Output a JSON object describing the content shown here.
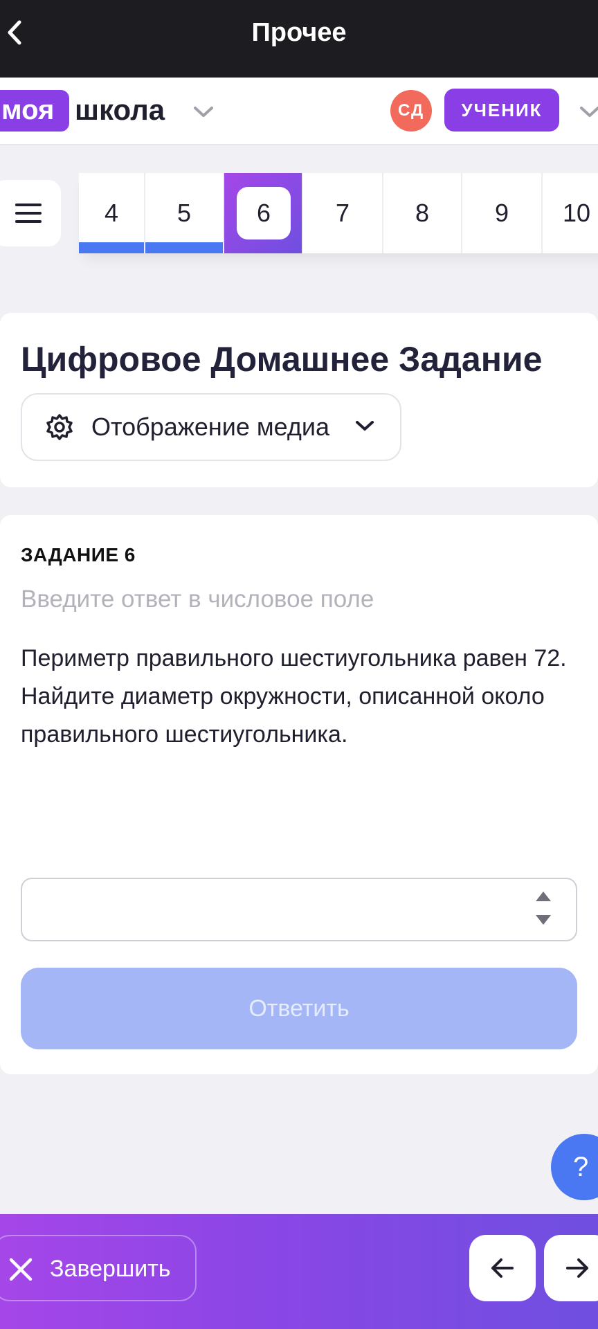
{
  "topbar": {
    "title": "Прочее"
  },
  "header": {
    "logo_part1": "моя",
    "logo_part2": "школа",
    "avatar_initials": "СД",
    "role": "УЧЕНИК"
  },
  "tasks": {
    "items": [
      {
        "label": "4",
        "state": "done"
      },
      {
        "label": "5",
        "state": "done"
      },
      {
        "label": "6",
        "state": "active"
      },
      {
        "label": "7",
        "state": "pending"
      },
      {
        "label": "8",
        "state": "pending"
      },
      {
        "label": "9",
        "state": "pending"
      },
      {
        "label": "10",
        "state": "pending"
      }
    ]
  },
  "homework": {
    "title": "Цифровое Домашнее Задание",
    "media_label": "Отображение медиа"
  },
  "task": {
    "label": "ЗАДАНИЕ 6",
    "hint": "Введите ответ в числовое поле",
    "text": "Периметр правильного шестиугольника равен 72. Найдите диаметр окружности, описанной около правильного шестиугольника.",
    "answer_value": "",
    "submit_label": "Ответить"
  },
  "help": {
    "label": "?"
  },
  "footer": {
    "finish_label": "Завершить"
  },
  "colors": {
    "brand_purple": "#8a3ee6",
    "progress_blue": "#4a78f2",
    "submit_disabled": "#a4b6f6",
    "avatar_red": "#f26a5c"
  },
  "icons": [
    "back-arrow-icon",
    "chevron-down-icon",
    "hamburger-menu-icon",
    "gear-icon",
    "close-icon",
    "arrow-left-icon",
    "arrow-right-icon"
  ]
}
